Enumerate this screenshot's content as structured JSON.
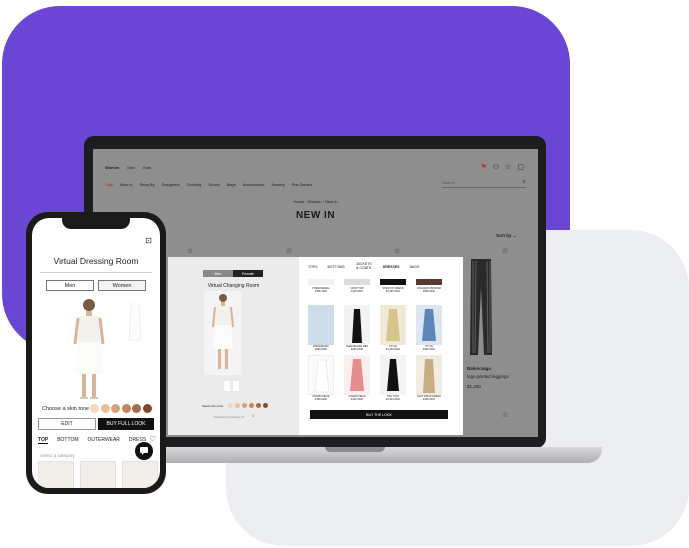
{
  "colors": {
    "background_purple": "#6b45d4",
    "background_gray": "#eceef1",
    "frame_dark": "#1d1d1f",
    "button_dark": "#111111",
    "skin_tones": [
      "#f3d8c2",
      "#e7bf9a",
      "#d6a27a",
      "#bf8660",
      "#a66b47",
      "#7d4b2c"
    ]
  },
  "screen": {
    "top_nav": [
      "Women",
      "Men",
      "Kids"
    ],
    "categories": [
      "Sale",
      "New In",
      "Shop By",
      "Designers",
      "Clothing",
      "Shoes",
      "Bags",
      "Accessories",
      "Jewelry",
      "Pre-Owned"
    ],
    "search_placeholder": "Search",
    "breadcrumb": "Home  ›  Women  ›  New In",
    "page_title": "NEW IN",
    "sort_label": "Sort by  ⌄",
    "side_product": {
      "brand": "Balenciaga",
      "name": "logo-printed leggings",
      "price": "$1,260"
    }
  },
  "modal": {
    "toggle": [
      "Men",
      "Female"
    ],
    "title": "Virtual Changing Room",
    "skin_label": "Select skin tone",
    "powered_by": "Powered by Revery AI",
    "tabs": [
      "TOPS",
      "BOTTOMS",
      "JACKETS & COATS",
      "DRESSES",
      "BAGS"
    ],
    "items": [
      {
        "name": "PHENOMENAL",
        "price": "€390.0000"
      },
      {
        "name": "CROP TOP",
        "price": "€425.0000"
      },
      {
        "name": "STRETCH DRESS",
        "price": "€2,940.0000"
      },
      {
        "name": "ORGANZA PRINTED",
        "price": "€965.0000"
      },
      {
        "name": "PARAMETRIC",
        "price": "€490.0000"
      },
      {
        "name": "SLEEVELESS MIDI",
        "price": "€690.0000"
      },
      {
        "name": "STYLE",
        "price": "€1,490.0000"
      },
      {
        "name": "STYLE",
        "price": "€690.0000"
      },
      {
        "name": "CHARM PIECE",
        "price": "€390.0000"
      },
      {
        "name": "CHARM PIECE",
        "price": "€420.0000"
      },
      {
        "name": "THE TOTE",
        "price": "€2,940.0000"
      },
      {
        "name": "MAXI WRAP DRESS",
        "price": "€490.0000"
      }
    ],
    "buy_button": "BUY THE LOOK"
  },
  "phone": {
    "title": "Virtual Dressing Room",
    "toggle": [
      "Men",
      "Women"
    ],
    "skin_label": "Choose a skin tone",
    "edit_button": "EDIT",
    "buy_button": "BUY FULL LOOK",
    "tabs": [
      "TOP",
      "BOTTOM",
      "OUTERWEAR",
      "DRESS"
    ],
    "category_placeholder": "Select a category"
  }
}
